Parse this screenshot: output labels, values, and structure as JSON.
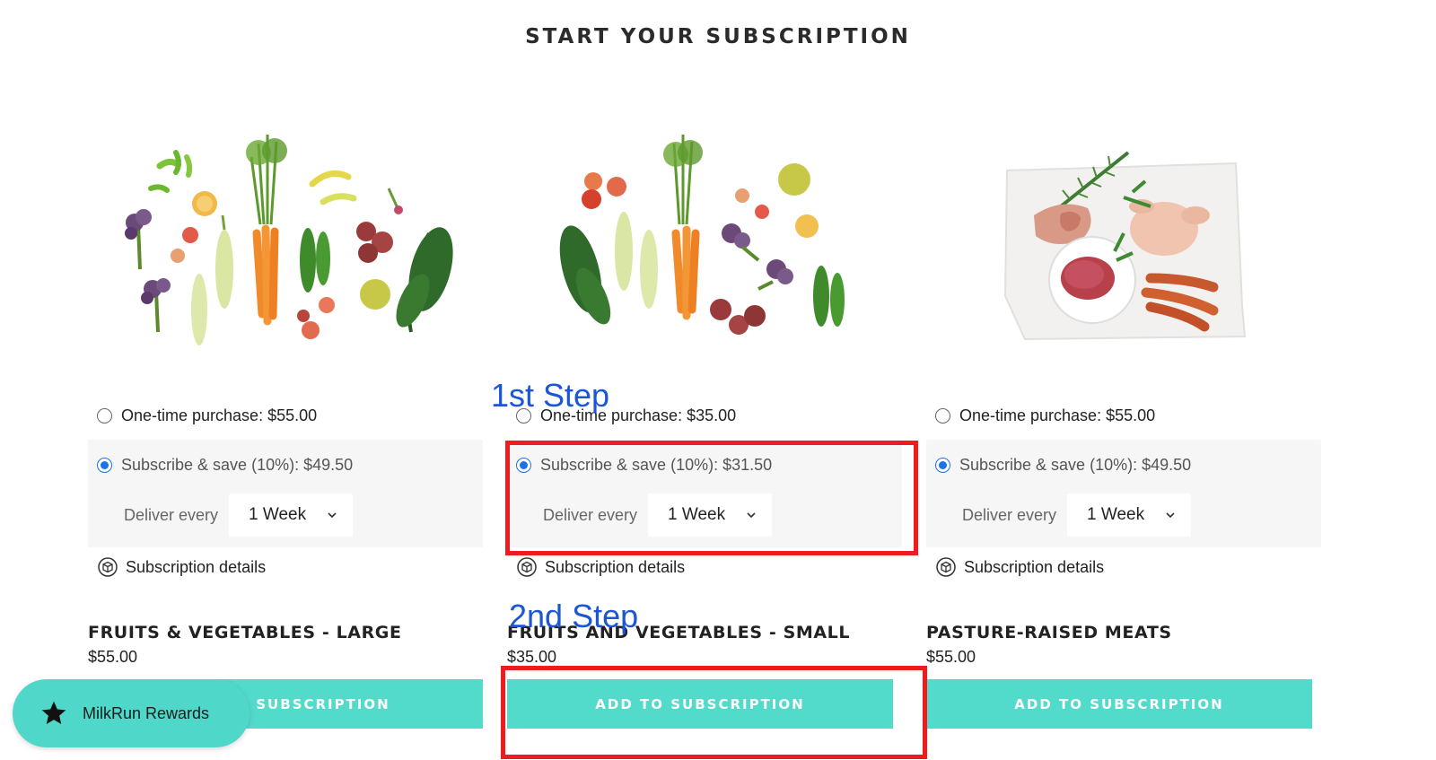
{
  "page": {
    "title": "START YOUR SUBSCRIPTION"
  },
  "products": [
    {
      "onetime_label": "One-time purchase: $55.00",
      "subscribe_label": "Subscribe & save (10%): $49.50",
      "deliver_label": "Deliver every",
      "frequency": "1 Week",
      "details_label": "Subscription details",
      "title": "FRUITS & VEGETABLES - LARGE",
      "price": "$55.00",
      "button_label": "ADD TO SUBSCRIPTION",
      "selected_option": "subscribe"
    },
    {
      "onetime_label": "One-time purchase: $35.00",
      "subscribe_label": "Subscribe & save (10%): $31.50",
      "deliver_label": "Deliver every",
      "frequency": "1 Week",
      "details_label": "Subscription details",
      "title": "FRUITS AND VEGETABLES - SMALL",
      "price": "$35.00",
      "button_label": "ADD TO SUBSCRIPTION",
      "selected_option": "subscribe"
    },
    {
      "onetime_label": "One-time purchase: $55.00",
      "subscribe_label": "Subscribe & save (10%): $49.50",
      "deliver_label": "Deliver every",
      "frequency": "1 Week",
      "details_label": "Subscription details",
      "title": "PASTURE-RAISED MEATS",
      "price": "$55.00",
      "button_label": "ADD TO SUBSCRIPTION",
      "selected_option": "subscribe"
    }
  ],
  "annotations": {
    "step1": "1st Step",
    "step2": "2nd Step"
  },
  "rewards": {
    "label": "MilkRun Rewards",
    "icon": "star-icon"
  },
  "colors": {
    "accent": "#52dacb",
    "radio_selected": "#1a73e8",
    "annotation_text": "#1a56d6",
    "highlight": "#ee1c1c",
    "panel_bg": "#f6f6f6"
  }
}
